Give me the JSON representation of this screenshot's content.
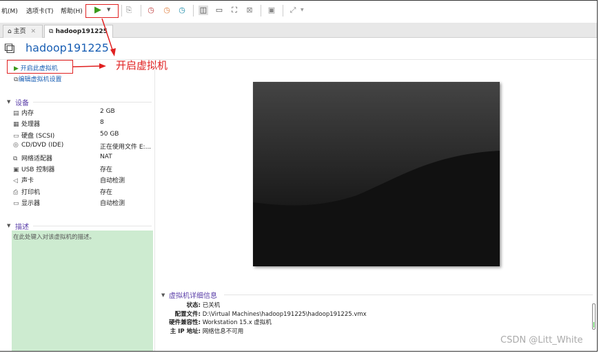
{
  "menu": [
    "机(M)",
    "选项卡(T)",
    "帮助(H)"
  ],
  "tabs": [
    {
      "label": "主页",
      "icon": "home-icon"
    },
    {
      "label": "hadoop191225",
      "icon": "vm-icon"
    }
  ],
  "vm_title": "hadoop191225",
  "actions": {
    "power_on": "开启此虚拟机",
    "edit_settings": "编辑虚拟机设置"
  },
  "annotation": "开启虚拟机",
  "devices_header": "设备",
  "devices": [
    {
      "name": "内存",
      "value": "2 GB",
      "icon": "memory-icon"
    },
    {
      "name": "处理器",
      "value": "8",
      "icon": "cpu-icon"
    },
    {
      "name": "硬盘 (SCSI)",
      "value": "50 GB",
      "icon": "disk-icon"
    },
    {
      "name": "CD/DVD (IDE)",
      "value": "正在使用文件 E:...",
      "icon": "cd-icon"
    },
    {
      "name": "网络适配器",
      "value": "NAT",
      "icon": "network-icon"
    },
    {
      "name": "USB 控制器",
      "value": "存在",
      "icon": "usb-icon"
    },
    {
      "name": "声卡",
      "value": "自动检测",
      "icon": "speaker-icon"
    },
    {
      "name": "打印机",
      "value": "存在",
      "icon": "printer-icon"
    },
    {
      "name": "显示器",
      "value": "自动检测",
      "icon": "monitor-icon"
    }
  ],
  "description_header": "描述",
  "description_placeholder": "在此处键入对该虚拟机的描述。",
  "details_header": "虚拟机详细信息",
  "details": [
    {
      "key": "状态:",
      "value": "已关机"
    },
    {
      "key": "配置文件:",
      "value": "D:\\Virtual Machines\\hadoop191225\\hadoop191225.vmx"
    },
    {
      "key": "硬件兼容性:",
      "value": "Workstation 15.x 虚拟机"
    },
    {
      "key": "主 IP 地址:",
      "value": "网络信息不可用"
    }
  ],
  "watermark": "CSDN @Litt_White",
  "colors": {
    "accent": "#1a5fb4",
    "annotation": "#e02020",
    "desc_bg": "#cdebd0",
    "play": "#3a9a1a"
  }
}
